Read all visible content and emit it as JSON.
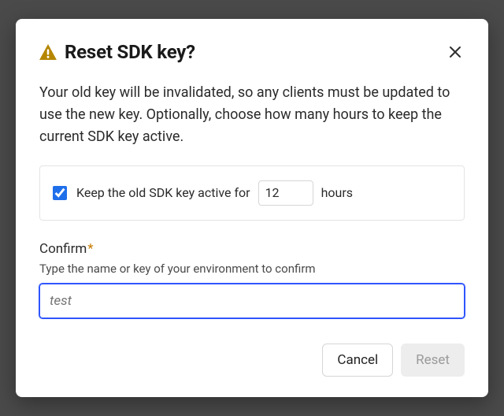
{
  "modal": {
    "title": "Reset SDK key?",
    "description": "Your old key will be invalidated, so any clients must be updated to use the new key. Optionally, choose how many hours to keep the current SDK key active.",
    "keep_active": {
      "checked": true,
      "label_before": "Keep the old SDK key active for",
      "hours_value": "12",
      "label_after": "hours"
    },
    "confirm": {
      "label": "Confirm",
      "required_marker": "*",
      "hint": "Type the name or key of your environment to confirm",
      "placeholder": "test"
    },
    "buttons": {
      "cancel": "Cancel",
      "reset": "Reset"
    }
  }
}
